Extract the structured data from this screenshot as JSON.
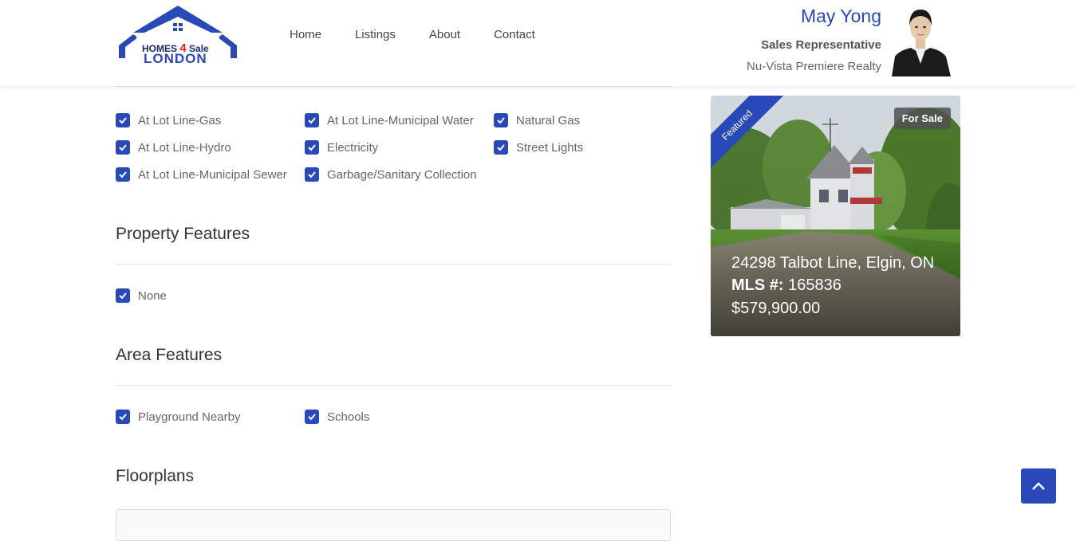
{
  "header": {
    "logo": {
      "line1": "HOMES 4 Sale",
      "line2": "LONDON",
      "accent": "#2a49b8",
      "accent2": "#e0201a"
    },
    "nav": [
      "Home",
      "Listings",
      "About",
      "Contact"
    ],
    "agent": {
      "name": "May Yong",
      "title": "Sales Representative",
      "company": "Nu-Vista Premiere Realty"
    }
  },
  "utilities": {
    "items": [
      "At Lot Line-Gas",
      "At Lot Line-Municipal Water",
      "Natural Gas",
      "At Lot Line-Hydro",
      "Electricity",
      "Street Lights",
      "At Lot Line-Municipal Sewer",
      "Garbage/Sanitary Collection"
    ]
  },
  "property_features": {
    "title": "Property Features",
    "items": [
      "None"
    ]
  },
  "area_features": {
    "title": "Area Features",
    "items": [
      "Playground Nearby",
      "Schools"
    ]
  },
  "floorplans": {
    "title": "Floorplans"
  },
  "featured_card": {
    "ribbon": "Featured",
    "badge": "For Sale",
    "address": "24298 Talbot Line, Elgin, ON",
    "mls_label": "MLS #:",
    "mls_number": "165836",
    "price": "$579,900.00"
  },
  "colors": {
    "primary": "#2a49b8",
    "text": "#666666",
    "heading": "#333333"
  },
  "icons": {
    "checkbox": "checkmark-icon",
    "scroll_top": "chevron-up-icon"
  }
}
